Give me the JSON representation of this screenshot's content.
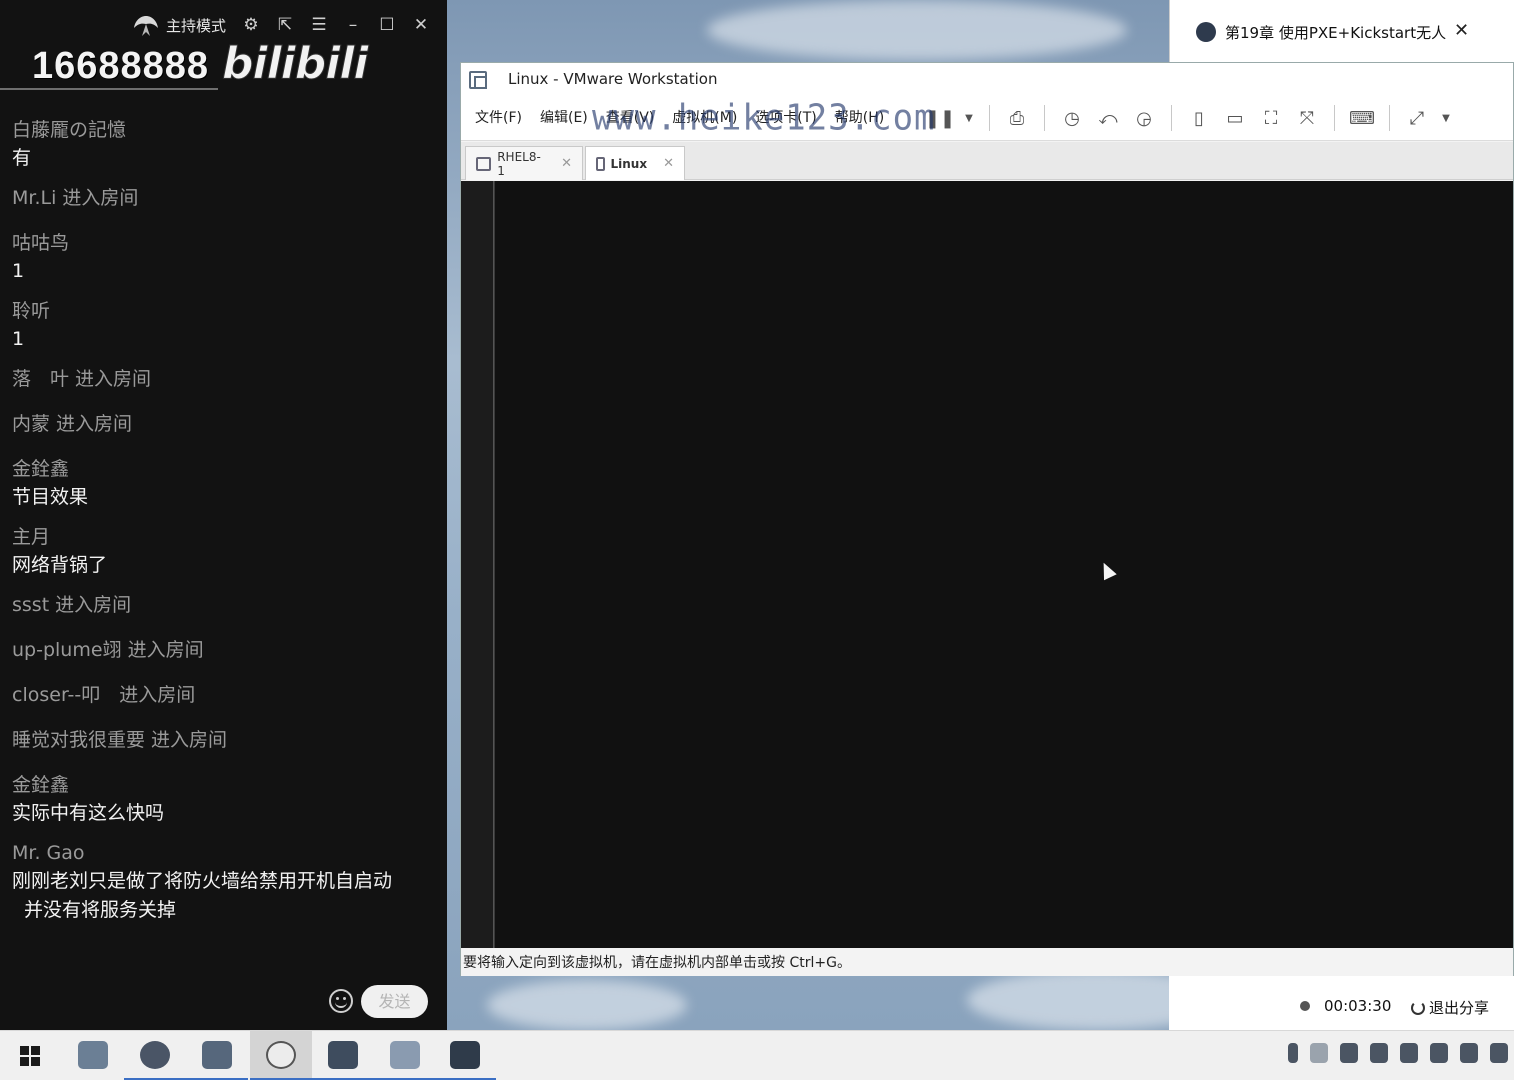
{
  "chat": {
    "host_mode_label": "主持模式",
    "room_number": "16688888",
    "logo_text": "bilibili",
    "messages": [
      {
        "user": "白藤龎の記憶",
        "text": "有"
      },
      {
        "enter": "Mr.Li 进入房间"
      },
      {
        "user": "咕咕鸟",
        "text": "1"
      },
      {
        "user": "聆听",
        "text": "1"
      },
      {
        "enter": "落　叶 进入房间"
      },
      {
        "enter": "内蒙 进入房间"
      },
      {
        "user": "金銓鑫",
        "text": "节目效果"
      },
      {
        "user": "主月",
        "text": "网络背锅了"
      },
      {
        "enter": "ssst 进入房间"
      },
      {
        "enter": "up-plume翊 进入房间"
      },
      {
        "enter": "closer--叩　进入房间"
      },
      {
        "enter": "睡觉对我很重要 进入房间"
      },
      {
        "user": "金銓鑫",
        "text": "实际中有这么快吗"
      },
      {
        "user": "Mr. Gao",
        "text": "刚刚老刘只是做了将防火墙给禁用开机自启动",
        "text2": "并没有将服务关掉"
      }
    ],
    "send_label": "发送"
  },
  "vmware": {
    "title": "Linux - VMware Workstation",
    "menu": [
      "文件(F)",
      "编辑(E)",
      "查看(V)",
      "虚拟机(M)",
      "选项卡(T)",
      "帮助(H)"
    ],
    "watermark": "www.heike123.com",
    "tabs": [
      {
        "label": "RHEL8-1",
        "active": false
      },
      {
        "label": "Linux",
        "active": true
      }
    ],
    "status_text": "要将输入定向到该虚拟机，请在虚拟机内部单击或按 Ctrl+G。"
  },
  "share": {
    "title": "第19章 使用PXE+Kickstart无人",
    "close_glyph": "✕",
    "elapsed": "00:03:30",
    "exit_label": "退出分享"
  },
  "colors": {
    "chat_bg": "#121212",
    "vm_screen": "#111111",
    "accent": "#3b6fc4"
  }
}
